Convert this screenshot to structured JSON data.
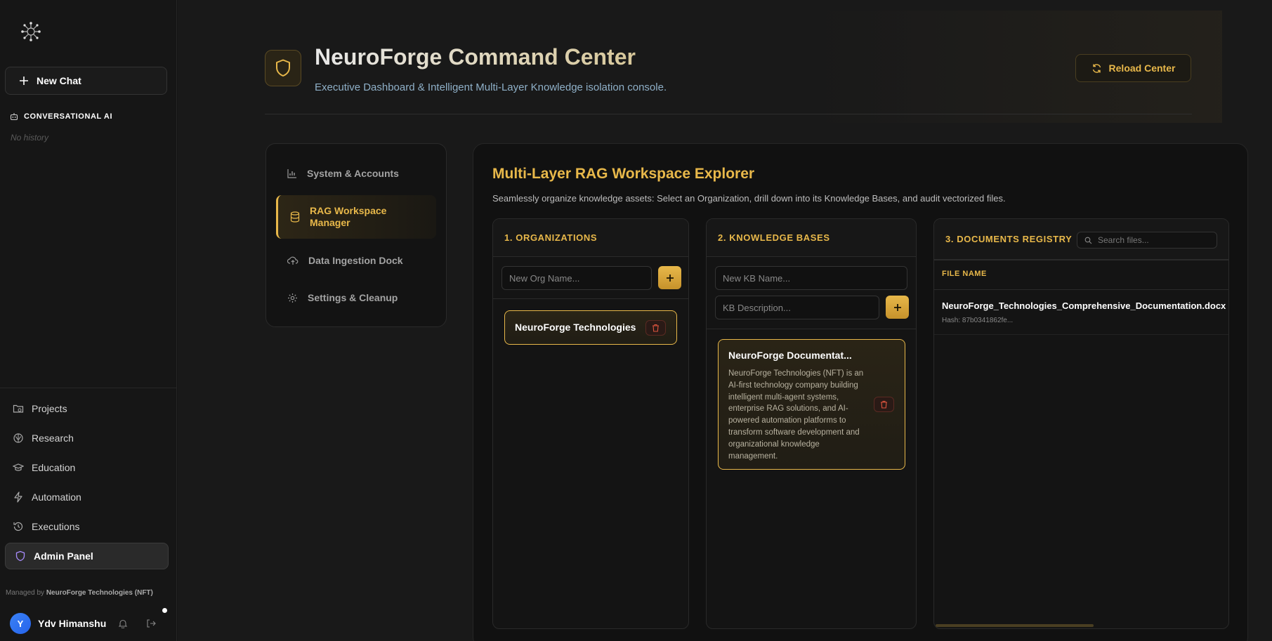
{
  "sidebar": {
    "logo_icon": "neural-network-logo",
    "new_chat_label": "New Chat",
    "section_label": "CONVERSATIONAL AI",
    "no_history": "No history",
    "nav": [
      {
        "label": "Projects",
        "icon": "folder-icon"
      },
      {
        "label": "Research",
        "icon": "brain-icon"
      },
      {
        "label": "Education",
        "icon": "graduation-cap-icon"
      },
      {
        "label": "Automation",
        "icon": "lightning-icon"
      },
      {
        "label": "Executions",
        "icon": "history-icon"
      },
      {
        "label": "Admin Panel",
        "icon": "shield-icon"
      }
    ],
    "managed_prefix": "Managed by",
    "managed_org": "NeuroForge Technologies (NFT)",
    "user": {
      "initial": "Y",
      "name": "Ydv Himanshu"
    }
  },
  "header": {
    "title": "NeuroForge Command Center",
    "subtitle": "Executive Dashboard & Intelligent Multi-Layer Knowledge isolation console.",
    "reload_label": "Reload Center"
  },
  "tabs": [
    {
      "label": "System & Accounts",
      "icon": "bar-chart-icon"
    },
    {
      "label": "RAG Workspace Manager",
      "icon": "database-icon",
      "active": true
    },
    {
      "label": "Data Ingestion Dock",
      "icon": "cloud-upload-icon"
    },
    {
      "label": "Settings & Cleanup",
      "icon": "gear-icon"
    }
  ],
  "explorer": {
    "title": "Multi-Layer RAG Workspace Explorer",
    "description": "Seamlessly organize knowledge assets: Select an Organization, drill down into its Knowledge Bases, and audit vectorized files.",
    "organizations": {
      "heading": "1. ORGANIZATIONS",
      "input_placeholder": "New Org Name...",
      "items": [
        "NeuroForge Technologies"
      ]
    },
    "knowledge_bases": {
      "heading": "2. KNOWLEDGE BASES",
      "name_placeholder": "New KB Name...",
      "desc_placeholder": "KB Description...",
      "items": [
        {
          "name": "NeuroForge Documentat...",
          "description": "NeuroForge Technologies (NFT) is an AI-first technology company building intelligent multi-agent systems, enterprise RAG solutions, and AI-powered automation platforms to transform software development and organizational knowledge management."
        }
      ]
    },
    "documents": {
      "heading": "3. DOCUMENTS REGISTRY",
      "search_placeholder": "Search files...",
      "column": "FILE NAME",
      "files": [
        {
          "name": "NeuroForge_Technologies_Comprehensive_Documentation.docx",
          "hash": "Hash: 87b0341862fe..."
        }
      ]
    }
  },
  "colors": {
    "accent": "#e8b84a",
    "background": "#191919",
    "danger": "#d9534f"
  }
}
